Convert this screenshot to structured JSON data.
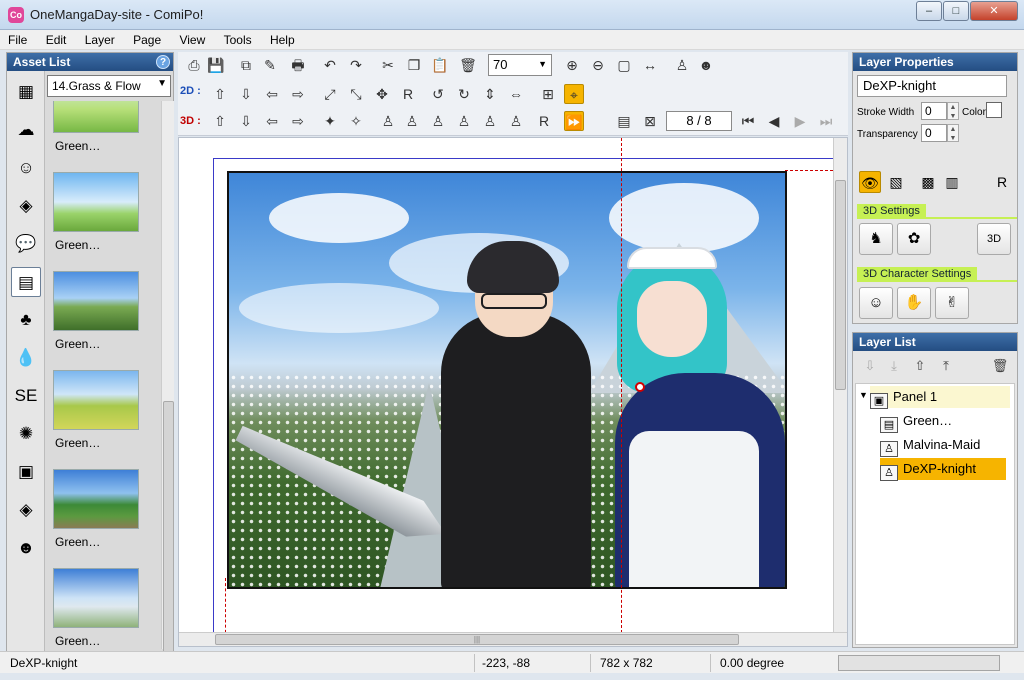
{
  "window": {
    "title": "OneMangaDay-site - ComiPo!",
    "app_icon": "comipo-logo-icon",
    "buttons": {
      "minimize": "–",
      "maximize": "□",
      "close": "✕"
    }
  },
  "menu": [
    "File",
    "Edit",
    "Layer",
    "Page",
    "View",
    "Tools",
    "Help"
  ],
  "asset_list": {
    "title": "Asset List",
    "help_glyph": "?",
    "category_select": "14.Grass & Flow",
    "categories": [
      "layout-grid-icon",
      "balloon-icon",
      "character-icon",
      "3d-box-icon",
      "speech-bubble-icon",
      "background-icon",
      "tree-icon",
      "drop-icon",
      "se-text-icon",
      "burst-effect-icon",
      "user-background-icon",
      "user-3d-icon",
      "face-icon"
    ],
    "category_glyphs": [
      "▦",
      "☁",
      "☺",
      "◈",
      "💬",
      "▤",
      "♣",
      "💧",
      "SE",
      "✺",
      "▣",
      "◈",
      "☻"
    ],
    "thumbnails": [
      {
        "label": "Green…"
      },
      {
        "label": "Green…"
      },
      {
        "label": "Green…"
      },
      {
        "label": "Green…"
      },
      {
        "label": "Green…"
      },
      {
        "label": "Green…"
      }
    ]
  },
  "toolbar": {
    "zoom_value": "70",
    "page_indicator": "8 / 8",
    "label_2d": "2D :",
    "label_3d": "3D :",
    "row1_icons": [
      "print-icon",
      "save-icon",
      "copy-page-icon",
      "tweet-icon",
      "printer-icon",
      "undo-icon",
      "redo-icon",
      "cut-icon",
      "copy-icon",
      "paste-icon",
      "delete-icon"
    ],
    "row1_glyphs": [
      "⎙",
      "💾",
      "⧉",
      "✎",
      "🖶",
      "↶",
      "↷",
      "✂",
      "❐",
      "📋",
      "🗑"
    ],
    "row1_right_icons": [
      "zoom-in-icon",
      "zoom-out-icon",
      "fit-page-icon",
      "fit-width-icon",
      "light-icon",
      "character-face-icon"
    ],
    "row1_right_glyphs": [
      "⊕",
      "⊖",
      "▢",
      "↔",
      "♙",
      "☻"
    ],
    "row2_icons": [
      "move-up-icon",
      "move-down-icon",
      "move-left-icon",
      "move-right-icon",
      "scale-up-icon",
      "scale-down-icon",
      "fit-icon",
      "reset-icon",
      "rotate-left-icon",
      "rotate-right-icon",
      "flip-vertical-icon",
      "flip-horizontal-icon",
      "lock-icon",
      "pin-icon"
    ],
    "row2_glyphs": [
      "⇧",
      "⇩",
      "⇦",
      "⇨",
      "⤢",
      "⤡",
      "✥",
      "R",
      "↺",
      "↻",
      "⇕",
      "⇔",
      "⊞",
      "⌖"
    ],
    "row3_icons": [
      "3d-up-icon",
      "3d-down-icon",
      "3d-left-icon",
      "3d-right-icon",
      "3d-rotate-x-icon",
      "3d-rotate-y-icon",
      "pose-1-icon",
      "pose-2-icon",
      "pose-3-icon",
      "pose-4-icon",
      "pose-5-icon",
      "pose-6-icon",
      "3d-reset-icon",
      "fast-forward-icon"
    ],
    "row3_glyphs": [
      "⇧",
      "⇩",
      "⇦",
      "⇨",
      "✦",
      "✧",
      "♙",
      "♙",
      "♙",
      "♙",
      "♙",
      "♙",
      "R",
      "⏩"
    ],
    "page_nav_icons": [
      "page-settings-icon",
      "page-delete-icon",
      "first-page-icon",
      "prev-page-icon",
      "next-page-icon",
      "last-page-icon"
    ],
    "page_nav_glyphs": [
      "▤",
      "⊠",
      "⏮",
      "◀",
      "▶",
      "⏭"
    ]
  },
  "canvas": {
    "scroll_grip": "|||"
  },
  "layer_properties": {
    "title": "Layer Properties",
    "layer_name": "DeXP-knight",
    "stroke_width_label": "Stroke Width",
    "stroke_width_value": "0",
    "color_label": "Color",
    "transparency_label": "Transparency",
    "transparency_value": "0",
    "tab_icons": [
      "eye-icon",
      "image-icon",
      "checker-icon",
      "gradient-icon",
      "reset-icon"
    ],
    "tab_glyphs": [
      "👁",
      "▧",
      "▩",
      "▥",
      "R"
    ],
    "settings_3d_label": "3D Settings",
    "settings_3d_icons": [
      "3d-pose-icon",
      "3d-parts-icon",
      "3d-view-icon"
    ],
    "settings_3d_glyphs": [
      "♞",
      "✿",
      "3D"
    ],
    "character_settings_label": "3D Character Settings",
    "character_settings_icons": [
      "face-expression-icon",
      "body-pose-icon",
      "hands-icon"
    ],
    "character_settings_glyphs": [
      "☺",
      "✋",
      "✌"
    ]
  },
  "layer_list": {
    "title": "Layer List",
    "toolbar_icons": [
      "move-layer-down-icon",
      "move-layer-bottom-icon",
      "move-layer-up-icon",
      "move-layer-top-icon",
      "delete-layer-icon"
    ],
    "toolbar_glyphs": [
      "⇩",
      "⤓",
      "⇧",
      "⤒",
      "🗑"
    ],
    "expand_glyph": "▼",
    "panel_name": "Panel 1",
    "layers": [
      {
        "name": "Green…",
        "icon": "background-layer-icon",
        "glyph": "▤",
        "selected": false
      },
      {
        "name": "Malvina-Maid",
        "icon": "character-layer-icon",
        "glyph": "♙",
        "selected": false
      },
      {
        "name": "DeXP-knight",
        "icon": "character-layer-icon",
        "glyph": "♙",
        "selected": true
      }
    ]
  },
  "status": {
    "layer": "DeXP-knight",
    "coords": "-223, -88",
    "size": "782 x 782",
    "angle": "0.00 degree"
  },
  "colors": {
    "accent_header": "#244d82",
    "selected_highlight": "#f6b400",
    "section_green": "#c6f054"
  }
}
